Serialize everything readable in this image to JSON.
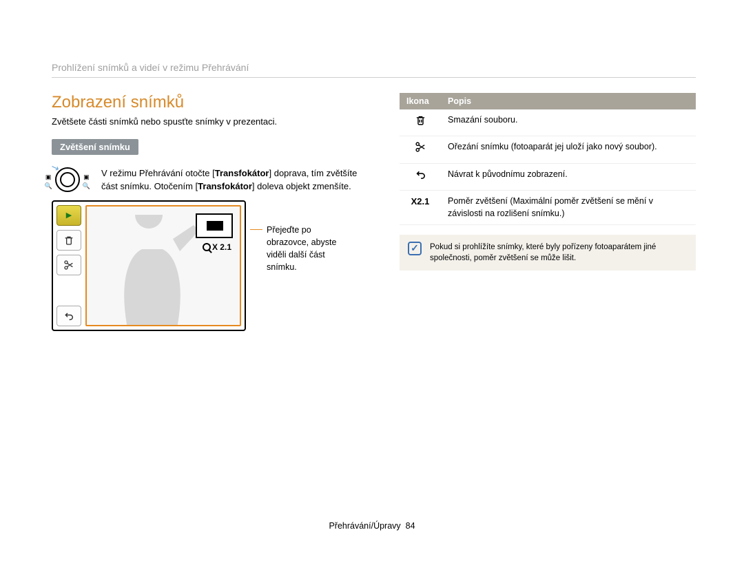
{
  "breadcrumb": "Prohlížení snímků a videí v režimu Přehrávání",
  "heading": "Zobrazení snímků",
  "subtitle": "Zvětšete části snímků nebo spusťte snímky v prezentaci.",
  "pill": "Zvětšení snímku",
  "zoom_instruction": {
    "pre": "V režimu Přehrávání otočte [",
    "b1": "Transfokátor",
    "mid1": "] doprava, tím zvětšíte část snímku. Otočením [",
    "b2": "Transfokátor",
    "mid2": "] doleva objekt zmenšíte."
  },
  "screenshot": {
    "zoom_label": "X 2.1"
  },
  "callout": "Přejeďte po obrazovce, abyste viděli další část snímku.",
  "table": {
    "header_icon": "Ikona",
    "header_desc": "Popis",
    "rows": [
      {
        "icon": "trash",
        "desc": "Smazání souboru."
      },
      {
        "icon": "scissors",
        "desc": "Ořezání snímku (fotoaparát jej uloží jako nový soubor)."
      },
      {
        "icon": "return",
        "desc": "Návrat k původnímu zobrazení."
      },
      {
        "icon": "ratio",
        "label": "X2.1",
        "desc": "Poměr zvětšení (Maximální poměr zvětšení se mění v závislosti na rozlišení snímku.)"
      }
    ]
  },
  "note": "Pokud si prohlížíte snímky, které byly pořízeny fotoaparátem jiné společnosti, poměr zvětšení se může lišit.",
  "footer": {
    "section": "Přehrávání/Úpravy",
    "page": "84"
  }
}
